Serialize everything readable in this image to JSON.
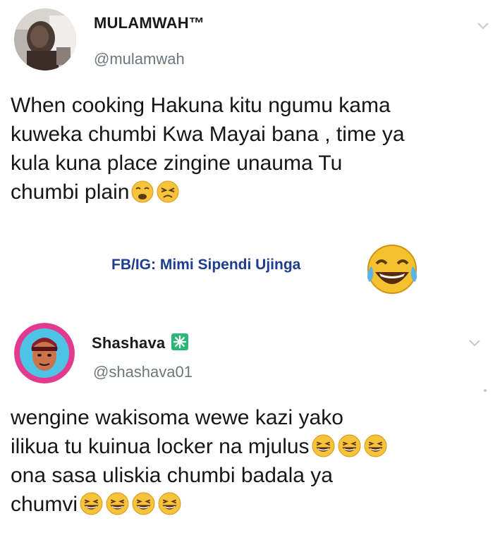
{
  "tweet1": {
    "display_name": "MULAMWAH™",
    "handle": "@mulamwah",
    "lines": [
      "When cooking Hakuna kitu ngumu kama",
      "kuweka chumbi Kwa Mayai bana , time ya",
      "kula kuna place zingine unauma Tu",
      "chumbi plain"
    ],
    "line4_emojis": [
      "weary-face-emoji",
      "persevering-face-emoji"
    ]
  },
  "watermark": {
    "text": "FB/IG: Mimi Sipendi Ujinga",
    "emoji": "tears-of-joy-emoji"
  },
  "tweet2": {
    "display_name": "Shashava",
    "badge_icon": "sparkle-badge-icon",
    "handle": "@shashava01",
    "lines": [
      "wengine wakisoma wewe kazi yako",
      "ilikua tu kuinua locker na mjulus",
      "ona sasa uliskia chumbi badala ya",
      "chumvi"
    ],
    "line2_emoji_count": 3,
    "line4_emoji_count": 4
  },
  "colors": {
    "name": "#1a1a1a",
    "handle": "#6e767d",
    "watermark": "#1d3d8f",
    "badge": "#2bb673"
  }
}
